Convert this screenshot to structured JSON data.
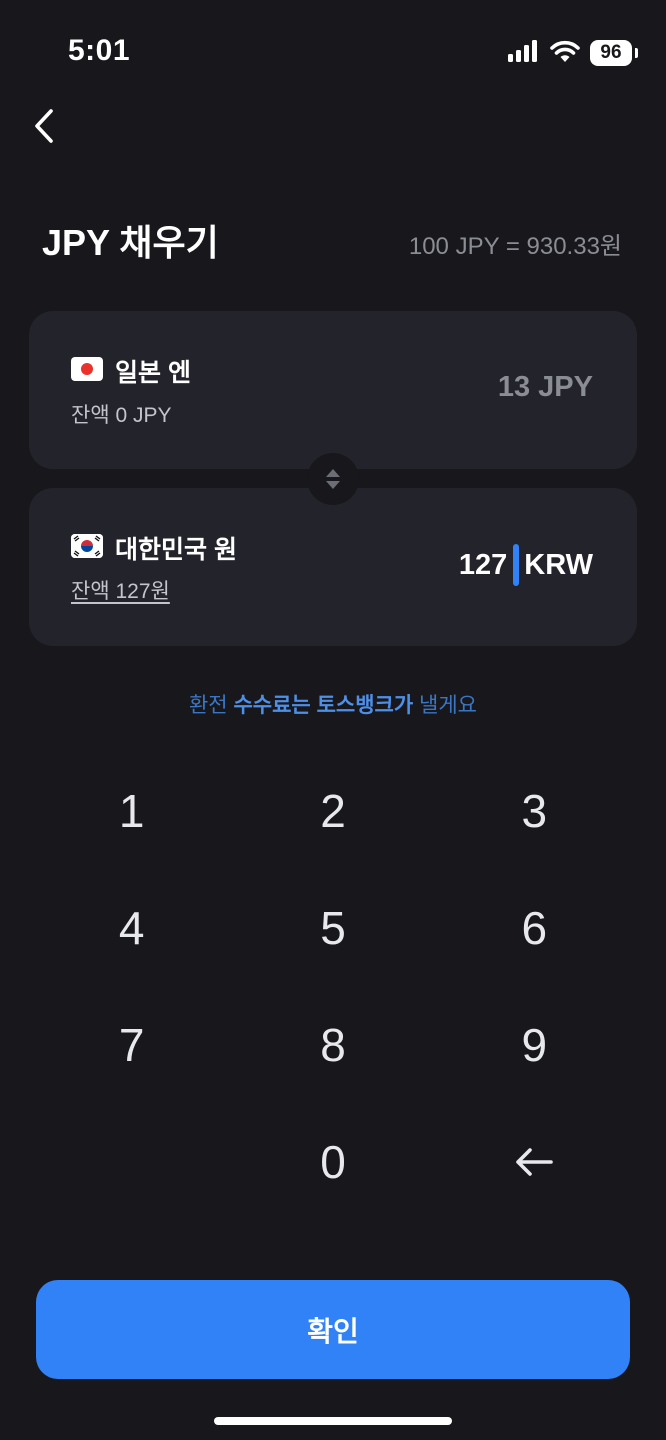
{
  "status_bar": {
    "time": "5:01",
    "battery": "96",
    "icons": [
      "cellular-signal-icon",
      "wifi-icon",
      "battery-icon"
    ]
  },
  "header": {
    "title": "JPY 채우기",
    "rate": "100 JPY = 930.33원"
  },
  "from_card": {
    "currency_name": "일본 엔",
    "balance": "잔액 0 JPY",
    "amount": "13 JPY",
    "flag": "japan-flag-icon"
  },
  "to_card": {
    "currency_name": "대한민국 원",
    "balance": "잔액 127원",
    "amount_value": "127",
    "amount_unit": "KRW",
    "flag": "korea-flag-icon"
  },
  "fee_note": {
    "prefix": "환전 ",
    "fee": "수수료는",
    "space": " ",
    "bank": "토스뱅크가",
    "suffix": " 낼게요"
  },
  "keypad": {
    "keys": [
      "1",
      "2",
      "3",
      "4",
      "5",
      "6",
      "7",
      "8",
      "9",
      "",
      "0",
      "←"
    ]
  },
  "confirm_button": "확인",
  "colors": {
    "background": "#17171c",
    "card": "#23242b",
    "accent": "#3182f6",
    "muted_text": "#8b8d94"
  }
}
